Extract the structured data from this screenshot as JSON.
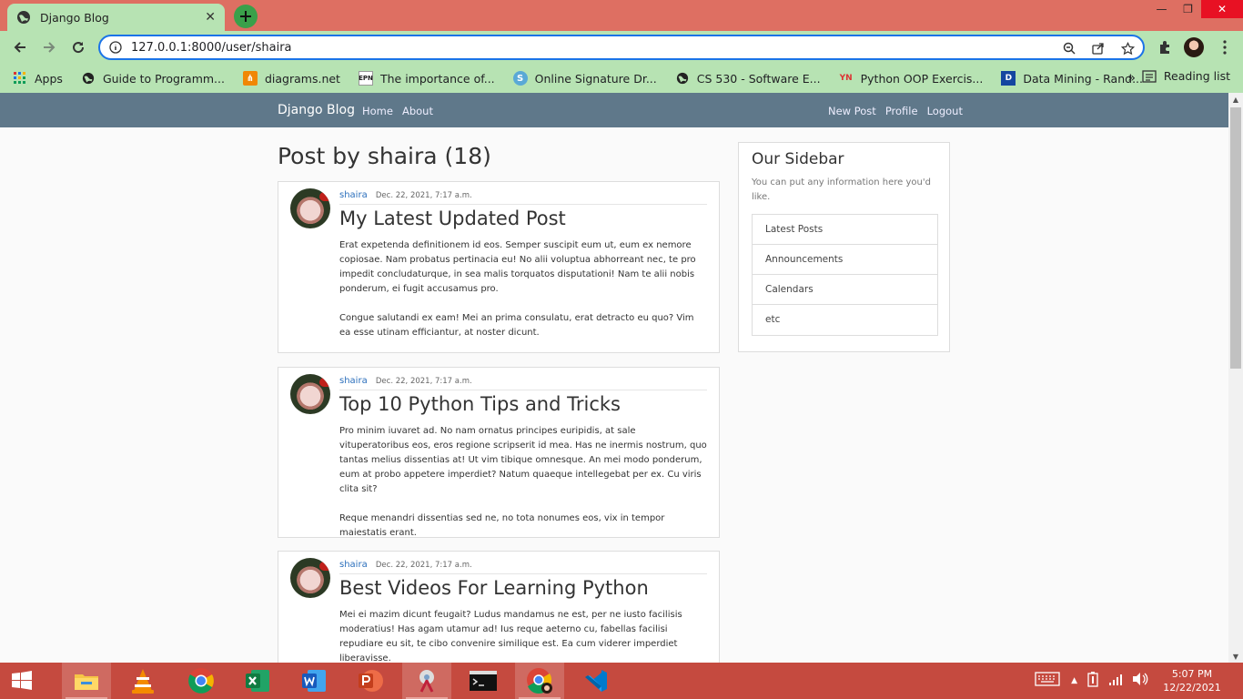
{
  "browser": {
    "tab_title": "Django Blog",
    "url": "127.0.0.1:8000/user/shaira",
    "bookmarks": [
      {
        "label": "Apps",
        "icon": "apps-grid-icon"
      },
      {
        "label": "Guide to Programm...",
        "icon": "globe-icon"
      },
      {
        "label": "diagrams.net",
        "icon": "diagrams-icon"
      },
      {
        "label": "The importance of...",
        "icon": "epn-icon"
      },
      {
        "label": "Online Signature Dr...",
        "icon": "signature-icon"
      },
      {
        "label": "CS 530 - Software E...",
        "icon": "globe-icon"
      },
      {
        "label": "Python OOP Exercis...",
        "icon": "pynative-icon"
      },
      {
        "label": "Data Mining - Rand...",
        "icon": "d-icon"
      }
    ],
    "more_bookmarks": "»",
    "reading_list": "Reading list"
  },
  "site": {
    "brand": "Django Blog",
    "nav_left": [
      "Home",
      "About"
    ],
    "nav_right": [
      "New Post",
      "Profile",
      "Logout"
    ]
  },
  "page_heading": "Post by shaira (18)",
  "posts": [
    {
      "author": "shaira",
      "date": "Dec. 22, 2021, 7:17 a.m.",
      "title": "My Latest Updated Post",
      "paragraphs": [
        "Erat expetenda definitionem id eos. Semper suscipit eum ut, eum ex nemore copiosae. Nam probatus pertinacia eu! No alii voluptua abhorreant nec, te pro impedit concludaturque, in sea malis torquatos disputationi! Nam te alii nobis ponderum, ei fugit accusamus pro.",
        "Congue salutandi ex eam! Mei an prima consulatu, erat detracto eu quo? Vim ea esse utinam efficiantur, at noster dicunt."
      ]
    },
    {
      "author": "shaira",
      "date": "Dec. 22, 2021, 7:17 a.m.",
      "title": "Top 10 Python Tips and Tricks",
      "paragraphs": [
        "Pro minim iuvaret ad. No nam ornatus principes euripidis, at sale vituperatoribus eos, eros regione scripserit id mea. Has ne inermis nostrum, quo tantas melius dissentias at! Ut vim tibique omnesque. An mei modo ponderum, eum at probo appetere imperdiet? Natum quaeque intellegebat per ex. Cu viris clita sit?",
        "Reque menandri dissentias sed ne, no tota nonumes eos, vix in tempor maiestatis erant."
      ]
    },
    {
      "author": "shaira",
      "date": "Dec. 22, 2021, 7:17 a.m.",
      "title": "Best Videos For Learning Python",
      "paragraphs": [
        "Mei ei mazim dicunt feugait? Ludus mandamus ne est, per ne iusto facilisis moderatius! Has agam utamur ad! Ius reque aeterno cu, fabellas facilisi repudiare eu sit, te cibo convenire similique est. Ea cum viderer imperdiet liberavisse."
      ]
    }
  ],
  "sidebar": {
    "title": "Our Sidebar",
    "description": "You can put any information here you'd like.",
    "items": [
      "Latest Posts",
      "Announcements",
      "Calendars",
      "etc"
    ]
  },
  "taskbar": {
    "apps": [
      "windows-start-icon",
      "file-explorer-icon",
      "vlc-icon",
      "chrome-icon",
      "excel-icon",
      "word-icon",
      "powerpoint-icon",
      "snipping-tool-icon",
      "terminal-icon",
      "chrome-profile-icon",
      "vscode-icon"
    ],
    "time": "5:07 PM",
    "date": "12/22/2021"
  }
}
